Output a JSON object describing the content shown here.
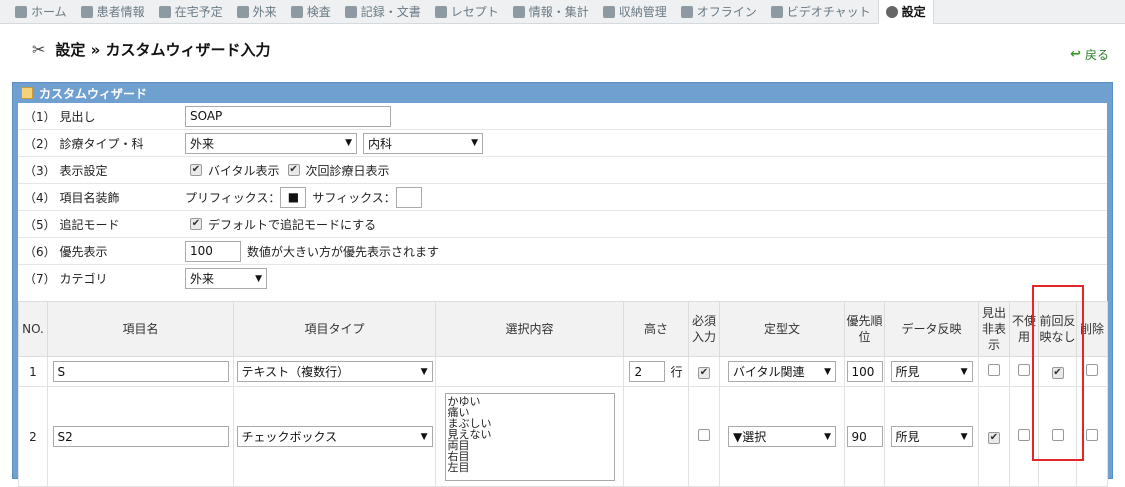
{
  "nav": [
    {
      "label": "ホーム",
      "icon": "home-icon",
      "active": false
    },
    {
      "label": "患者情報",
      "icon": "patient-icon",
      "active": false
    },
    {
      "label": "在宅予定",
      "icon": "clock-icon",
      "active": false
    },
    {
      "label": "外来",
      "icon": "person-icon",
      "active": false
    },
    {
      "label": "検査",
      "icon": "chart-icon",
      "active": false
    },
    {
      "label": "記録・文書",
      "icon": "document-icon",
      "active": false
    },
    {
      "label": "レセプト",
      "icon": "card-icon",
      "active": false
    },
    {
      "label": "情報・集計",
      "icon": "stats-icon",
      "active": false
    },
    {
      "label": "収納管理",
      "icon": "tag-icon",
      "active": false
    },
    {
      "label": "オフライン",
      "icon": "plug-icon",
      "active": false
    },
    {
      "label": "ビデオチャット",
      "icon": "video-icon",
      "active": false
    },
    {
      "label": "設定",
      "icon": "gear-icon",
      "active": true
    }
  ],
  "page_title": "設定 » カスタムウィザード入力",
  "back_label": "戻る",
  "panel_title": "カスタムウィザード",
  "form": {
    "heading": {
      "label": "（1） 見出し",
      "value": "SOAP"
    },
    "type": {
      "label": "（2） 診療タイプ・科",
      "type_value": "外来",
      "dept_value": "内科"
    },
    "display": {
      "label": "（3） 表示設定",
      "vital": "バイタル表示",
      "next": "次回診療日表示"
    },
    "decoration": {
      "label": "（4） 項目名装飾",
      "prefix_label": "プリフィックス：",
      "prefix_value": "■",
      "suffix_label": "サフィックス：",
      "suffix_value": ""
    },
    "append": {
      "label": "（5） 追記モード",
      "default": "デフォルトで追記モードにする"
    },
    "priority": {
      "label": "（6） 優先表示",
      "value": "100",
      "note": "数値が大きい方が優先表示されます"
    },
    "category": {
      "label": "（7） カテゴリ",
      "value": "外来"
    }
  },
  "table": {
    "headers": {
      "no": "NO.",
      "name": "項目名",
      "type": "項目タイプ",
      "options": "選択内容",
      "height": "高さ",
      "required": "必須入力",
      "template": "定型文",
      "order": "優先順位",
      "reflect": "データ反映",
      "hide": "見出非表示",
      "unused": "不使用",
      "noprev": "前回反映なし",
      "del": "削除"
    },
    "rows": [
      {
        "no": "1",
        "name": "S",
        "type": "テキスト（複数行）",
        "options": "",
        "height": "2",
        "height_unit": "行",
        "template": "バイタル関連",
        "order": "100",
        "reflect": "所見"
      },
      {
        "no": "2",
        "name": "S2",
        "type": "チェックボックス",
        "options": "かゆい\n痛い\nまぶしい\n見えない\n両目\n右目\n左目",
        "height": "",
        "height_unit": "",
        "template": "▼選択",
        "order": "90",
        "reflect": "所見"
      }
    ]
  },
  "highlight_color": "#e0282a"
}
